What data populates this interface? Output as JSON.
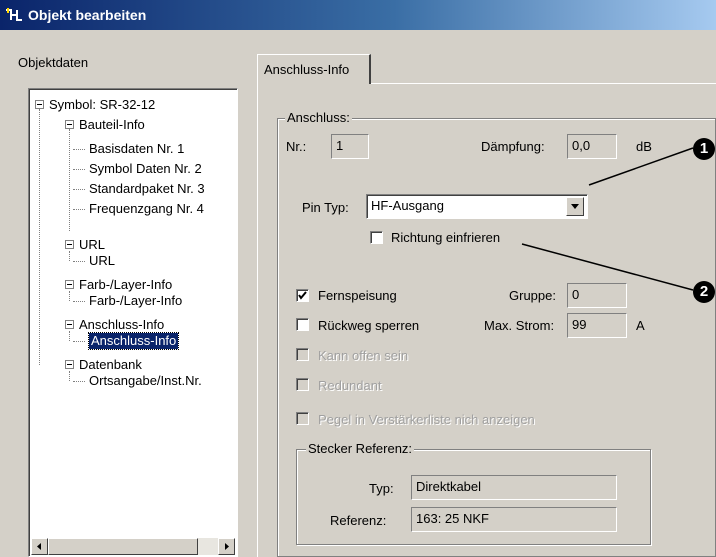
{
  "window": {
    "title": "Objekt bearbeiten"
  },
  "left_panel": {
    "heading": "Objektdaten",
    "tree": [
      {
        "label": "Symbol: SR-32-12"
      },
      {
        "label": "Bauteil-Info"
      },
      {
        "label": "Basisdaten Nr. 1"
      },
      {
        "label": "Symbol Daten Nr. 2"
      },
      {
        "label": "Standardpaket Nr. 3"
      },
      {
        "label": "Frequenzgang Nr. 4"
      },
      {
        "label": "URL"
      },
      {
        "label": "URL"
      },
      {
        "label": "Farb-/Layer-Info"
      },
      {
        "label": "Farb-/Layer-Info"
      },
      {
        "label": "Anschluss-Info"
      },
      {
        "label": "Anschluss-Info"
      },
      {
        "label": "Datenbank"
      },
      {
        "label": "Ortsangabe/Inst.Nr."
      }
    ]
  },
  "tab": {
    "label": "Anschluss-Info"
  },
  "anschluss": {
    "group_label": "Anschluss:",
    "nr_label": "Nr.:",
    "nr_value": "1",
    "daempfung_label": "Dämpfung:",
    "daempfung_value": "0,0",
    "daempfung_unit": "dB",
    "pin_typ_label": "Pin Typ:",
    "pin_typ_value": "HF-Ausgang",
    "richtung_label": "Richtung einfrieren",
    "fernspeisung_label": "Fernspeisung",
    "gruppe_label": "Gruppe:",
    "gruppe_value": "0",
    "rueckweg_label": "Rückweg sperren",
    "max_strom_label": "Max. Strom:",
    "max_strom_value": "99",
    "max_strom_unit": "A",
    "kann_offen_label": "Kann offen sein",
    "redundant_label": "Redundant",
    "pegel_label": "Pegel in Verstärkerliste nich anzeigen"
  },
  "stecker": {
    "group_label": "Stecker Referenz:",
    "typ_label": "Typ:",
    "typ_value": "Direktkabel",
    "referenz_label": "Referenz:",
    "referenz_value": "163: 25 NKF"
  },
  "callouts": {
    "one": "1",
    "two": "2"
  }
}
